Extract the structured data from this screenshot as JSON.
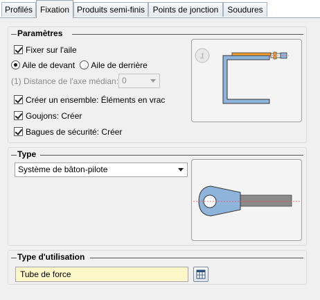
{
  "tabs": [
    {
      "label": "Profilés",
      "active": false
    },
    {
      "label": "Fixation",
      "active": true
    },
    {
      "label": "Produits semi-finis",
      "active": false
    },
    {
      "label": "Points de jonction",
      "active": false
    },
    {
      "label": "Soudures",
      "active": false
    }
  ],
  "parametres": {
    "title": "Paramètres",
    "fixer_aile": {
      "label": "Fixer sur l'aile",
      "checked": true
    },
    "aile_devant": {
      "label": "Aile de devant",
      "selected": true
    },
    "aile_derriere": {
      "label": "Aile de derrière",
      "selected": false
    },
    "distance": {
      "label": "(1) Distance de l'axe médian:",
      "value": "0"
    },
    "creer_ensemble": {
      "label": "Créer un ensemble: Éléments en vrac",
      "checked": true
    },
    "goujons": {
      "label": "Goujons: Créer",
      "checked": true
    },
    "bagues": {
      "label": "Bagues de sécurité: Créer",
      "checked": true
    },
    "info_badge": "1"
  },
  "type": {
    "title": "Type",
    "selected": "Système de bâton-pilote"
  },
  "utilisation": {
    "title": "Type d'utilisation",
    "value": "Tube de force"
  },
  "colors": {
    "part_blue": "#8fb4dc",
    "rod_gray": "#8a8a8a",
    "accent_orange": "#f0a030",
    "field_yellow": "#fbf7c8"
  }
}
